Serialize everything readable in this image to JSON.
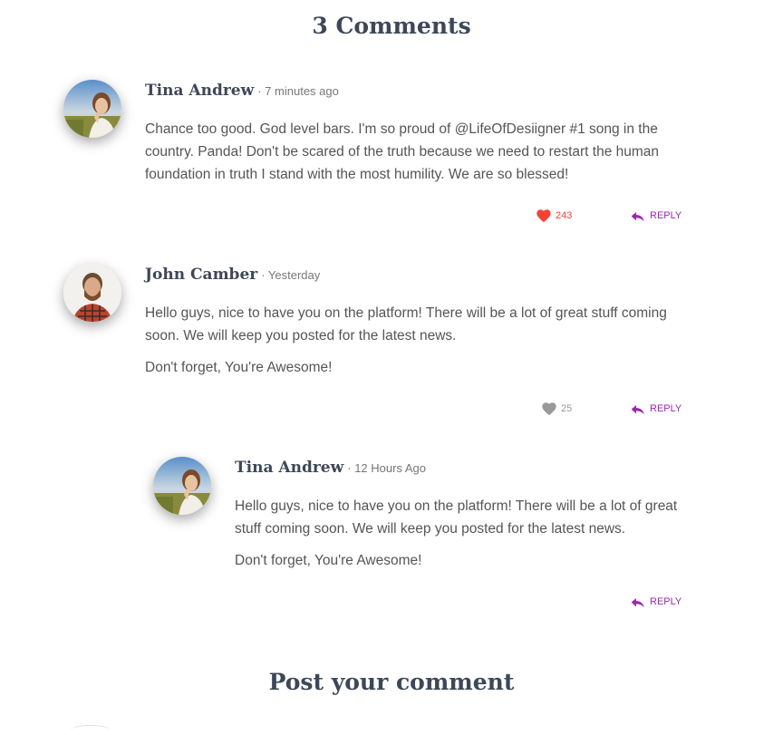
{
  "header": {
    "title": "3 Comments"
  },
  "comments": [
    {
      "author": "Tina Andrew",
      "meta": "· 7 minutes ago",
      "paragraphs": [
        "Chance too good. God level bars. I'm so proud of @LifeOfDesiigner #1 song in the country. Panda! Don't be scared of the truth because we need to restart the human foundation in truth I stand with the most humility. We are so blessed!"
      ],
      "likes": "243",
      "liked": true,
      "reply_label": "REPLY"
    },
    {
      "author": "John Camber",
      "meta": "· Yesterday",
      "paragraphs": [
        "Hello guys, nice to have you on the platform! There will be a lot of great stuff coming soon. We will keep you posted for the latest news.",
        "Don't forget, You're Awesome!"
      ],
      "likes": "25",
      "liked": false,
      "reply_label": "REPLY"
    },
    {
      "author": "Tina Andrew",
      "meta": "· 12 Hours Ago",
      "paragraphs": [
        "Hello guys, nice to have you on the platform! There will be a lot of great stuff coming soon. We will keep you posted for the latest news.",
        "Don't forget, You're Awesome!"
      ],
      "reply_label": "REPLY"
    }
  ],
  "post_section": {
    "title": "Post your comment"
  },
  "colors": {
    "like_active": "#f44336",
    "like_inactive": "#999999",
    "accent": "#9c27b0",
    "heading": "#3c4858"
  },
  "icons": {
    "like": "heart-icon",
    "reply": "reply-arrow-icon"
  }
}
